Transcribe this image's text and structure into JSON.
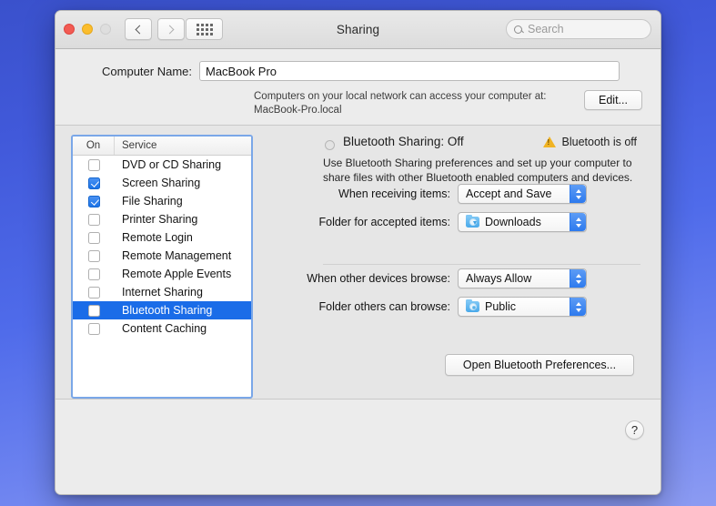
{
  "window": {
    "title": "Sharing",
    "traffic_lights": [
      "close",
      "minimize",
      "zoom"
    ]
  },
  "toolbar": {
    "back_icon": "chevron-left-icon",
    "forward_icon": "chevron-right-icon",
    "grid_icon": "show-all-grid-icon",
    "search": {
      "placeholder": "Search",
      "value": "",
      "icon": "search-icon"
    }
  },
  "name_section": {
    "label": "Computer Name:",
    "value": "MacBook Pro",
    "helper_line1": "Computers on your local network can access your computer at:",
    "helper_line2": "MacBook-Pro.local",
    "edit_label": "Edit..."
  },
  "service_table": {
    "columns": [
      "On",
      "Service"
    ],
    "rows": [
      {
        "label": "DVD or CD Sharing",
        "checked": false,
        "selected": false
      },
      {
        "label": "Screen Sharing",
        "checked": true,
        "selected": false
      },
      {
        "label": "File Sharing",
        "checked": true,
        "selected": false
      },
      {
        "label": "Printer Sharing",
        "checked": false,
        "selected": false
      },
      {
        "label": "Remote Login",
        "checked": false,
        "selected": false
      },
      {
        "label": "Remote Management",
        "checked": false,
        "selected": false
      },
      {
        "label": "Remote Apple Events",
        "checked": false,
        "selected": false
      },
      {
        "label": "Internet Sharing",
        "checked": false,
        "selected": false
      },
      {
        "label": "Bluetooth Sharing",
        "checked": false,
        "selected": true
      },
      {
        "label": "Content Caching",
        "checked": false,
        "selected": false
      }
    ]
  },
  "detail": {
    "status_icon": "status-dot-off",
    "title": "Bluetooth Sharing: Off",
    "warning_icon": "warning-triangle-icon",
    "warning_text": "Bluetooth is off",
    "description": "Use Bluetooth Sharing preferences and set up your computer to share files with other Bluetooth enabled computers and devices.",
    "fields": [
      {
        "label": "When receiving items:",
        "value": "Accept and Save",
        "icon": null
      },
      {
        "label": "Folder for accepted items:",
        "value": "Downloads",
        "icon": "folder-downloads-icon"
      },
      {
        "label": "When other devices browse:",
        "value": "Always Allow",
        "icon": null
      },
      {
        "label": "Folder others can browse:",
        "value": "Public",
        "icon": "folder-public-icon"
      }
    ],
    "open_prefs_label": "Open Bluetooth Preferences..."
  },
  "footer": {
    "help_label": "?",
    "help_icon": "help-question-icon"
  },
  "colors": {
    "accent_blue": "#1a6ce8",
    "checkbox_blue": "#1a73e8",
    "stepper_blue": "#2d7aee",
    "focus_ring": "#7aa7e8",
    "warning_yellow": "#f0b323",
    "desktop_top": "#3a51cc",
    "desktop_bottom": "#8c9bf2"
  }
}
